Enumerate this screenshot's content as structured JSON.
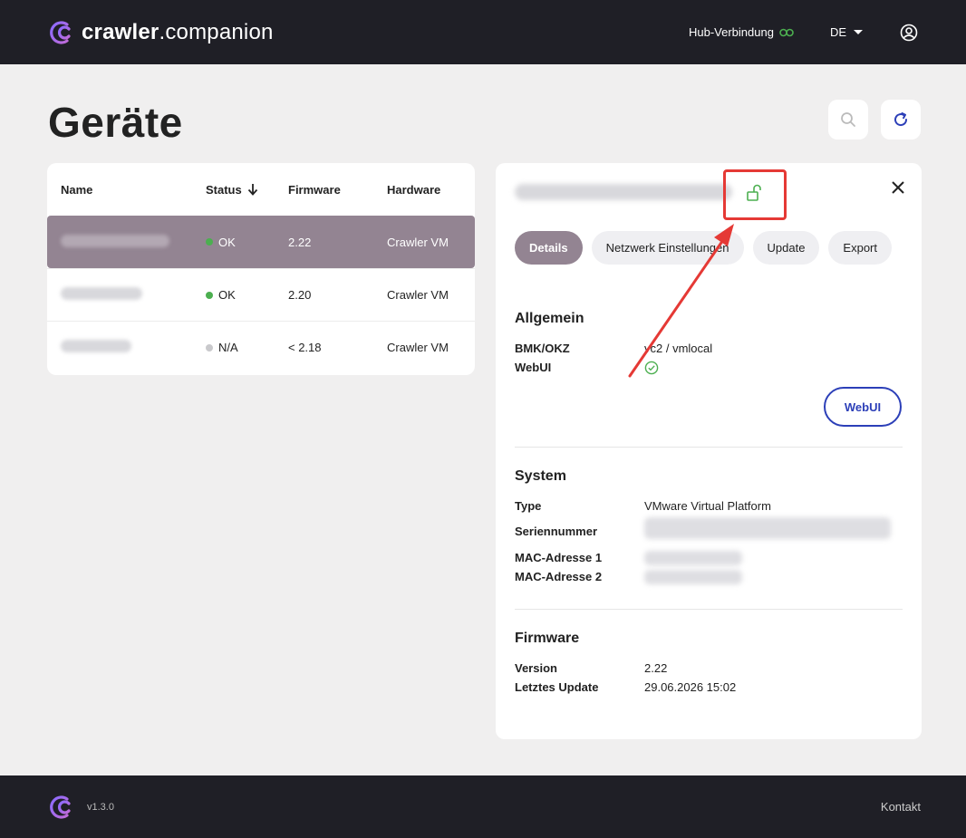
{
  "app": {
    "brand_bold": "crawler",
    "brand_rest": ".companion",
    "hub_label": "Hub-Verbindung",
    "language": "DE",
    "icons": {
      "logo": "crawler-logo-icon",
      "hub": "link-icon",
      "account": "user-circle-icon"
    },
    "accent": "#938492",
    "link_color": "#2c3fb8",
    "ok_color": "#4caf50"
  },
  "page": {
    "title": "Geräte"
  },
  "table": {
    "headers": {
      "name": "Name",
      "status": "Status",
      "firmware": "Firmware",
      "hardware": "Hardware"
    },
    "rows": [
      {
        "status": "OK",
        "status_color": "#4caf50",
        "firmware": "2.22",
        "hardware": "Crawler VM"
      },
      {
        "status": "OK",
        "status_color": "#4caf50",
        "firmware": "2.20",
        "hardware": "Crawler VM"
      },
      {
        "status": "N/A",
        "status_color": "#c9c9cc",
        "firmware": "< 2.18",
        "hardware": "Crawler VM"
      }
    ]
  },
  "detail": {
    "tabs": [
      "Details",
      "Netzwerk Einstellungen",
      "Update",
      "Export"
    ],
    "allgemein": {
      "heading": "Allgemein",
      "bmk_label": "BMK/OKZ",
      "bmk_value": "vc2 / vmlocal",
      "webui_label": "WebUI",
      "webui_button": "WebUI"
    },
    "system": {
      "heading": "System",
      "type_label": "Type",
      "type_value": "VMware Virtual Platform",
      "serial_label": "Seriennummer",
      "mac1_label": "MAC-Adresse 1",
      "mac2_label": "MAC-Adresse 2"
    },
    "firmware": {
      "heading": "Firmware",
      "version_label": "Version",
      "version_value": "2.22",
      "update_label": "Letztes Update",
      "update_value": "29.06.2026 15:02"
    }
  },
  "footer": {
    "version": "v1.3.0",
    "contact": "Kontakt"
  }
}
